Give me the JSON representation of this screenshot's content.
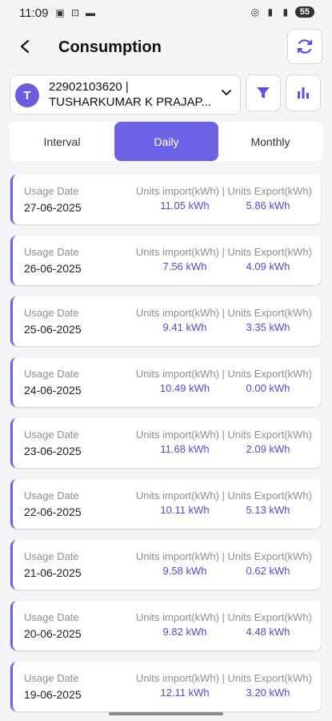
{
  "status": {
    "time": "11:09",
    "battery": "55"
  },
  "header": {
    "title": "Consumption"
  },
  "account": {
    "avatar_letter": "T",
    "number": "22902103620 |",
    "name": "TUSHARKUMAR K PRAJAP..."
  },
  "tabs": [
    "Interval",
    "Daily",
    "Monthly"
  ],
  "active_tab": "Daily",
  "card_labels": {
    "usage_date": "Usage Date",
    "units_header": "Units import(kWh) | Units Export(kWh)"
  },
  "records": [
    {
      "date": "27-06-2025",
      "import": "11.05 kWh",
      "export": "5.86 kWh"
    },
    {
      "date": "26-06-2025",
      "import": "7.56 kWh",
      "export": "4.09 kWh"
    },
    {
      "date": "25-06-2025",
      "import": "9.41 kWh",
      "export": "3.35 kWh"
    },
    {
      "date": "24-06-2025",
      "import": "10.49 kWh",
      "export": "0.00 kWh"
    },
    {
      "date": "23-06-2025",
      "import": "11.68 kWh",
      "export": "2.09 kWh"
    },
    {
      "date": "22-06-2025",
      "import": "10.11 kWh",
      "export": "5.13 kWh"
    },
    {
      "date": "21-06-2025",
      "import": "9.58 kWh",
      "export": "0.62 kWh"
    },
    {
      "date": "20-06-2025",
      "import": "9.82 kWh",
      "export": "4.48 kWh"
    },
    {
      "date": "19-06-2025",
      "import": "12.11 kWh",
      "export": "3.20 kWh"
    }
  ],
  "colors": {
    "accent": "#6c63e6",
    "value_text": "#5548d6"
  }
}
